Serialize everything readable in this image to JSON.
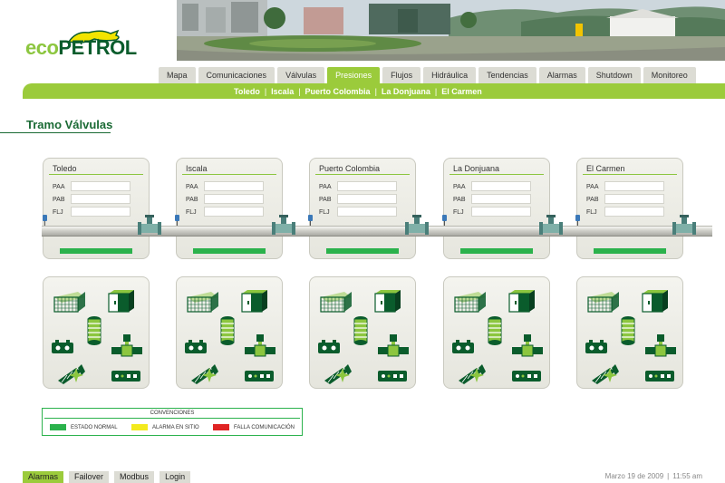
{
  "brand": {
    "logo_prefix": "eco",
    "logo_suffix": "PETROL"
  },
  "nav": {
    "tabs": [
      {
        "label": "Mapa"
      },
      {
        "label": "Comunicaciones"
      },
      {
        "label": "Válvulas"
      },
      {
        "label": "Presiones",
        "active": true
      },
      {
        "label": "Flujos"
      },
      {
        "label": "Hidráulica"
      },
      {
        "label": "Tendencias"
      },
      {
        "label": "Alarmas"
      },
      {
        "label": "Shutdown"
      },
      {
        "label": "Monitoreo"
      }
    ]
  },
  "sublinks": [
    "Toledo",
    "Iscala",
    "Puerto Colombia",
    "La Donjuana",
    "El Carmen"
  ],
  "page": {
    "title": "Tramo Válvulas"
  },
  "fields": {
    "paa": "PAA",
    "pab": "PAB",
    "flj": "FLJ"
  },
  "stations": [
    {
      "name": "Toledo",
      "paa": "",
      "pab": "",
      "flj": ""
    },
    {
      "name": "Iscala",
      "paa": "",
      "pab": "",
      "flj": ""
    },
    {
      "name": "Puerto Colombia",
      "paa": "",
      "pab": "",
      "flj": ""
    },
    {
      "name": "La Donjuana",
      "paa": "",
      "pab": "",
      "flj": ""
    },
    {
      "name": "El Carmen",
      "paa": "",
      "pab": "",
      "flj": ""
    }
  ],
  "equipment_icons": [
    "fence-icon",
    "cabinet-icon",
    "tank-icon",
    "battery-icon",
    "valve-actuator-icon",
    "satellite-icon",
    "rtu-icon"
  ],
  "legend": {
    "title": "CONVENCIONES",
    "items": [
      {
        "label": "ESTADO NORMAL",
        "color": "#2bb24c"
      },
      {
        "label": "ALARMA EN SITIO",
        "color": "#f3ea1e"
      },
      {
        "label": "FALLA COMUNICACIÓN",
        "color": "#e02424"
      }
    ]
  },
  "footer": {
    "buttons": [
      {
        "label": "Alarmas",
        "active": true
      },
      {
        "label": "Failover"
      },
      {
        "label": "Modbus"
      },
      {
        "label": "Login"
      }
    ],
    "date": "Marzo 19 de 2009",
    "time": "11:55 am"
  },
  "colors": {
    "accent": "#9bcb3b",
    "dark_green": "#0a5c2c",
    "status_ok": "#2bb24c"
  }
}
